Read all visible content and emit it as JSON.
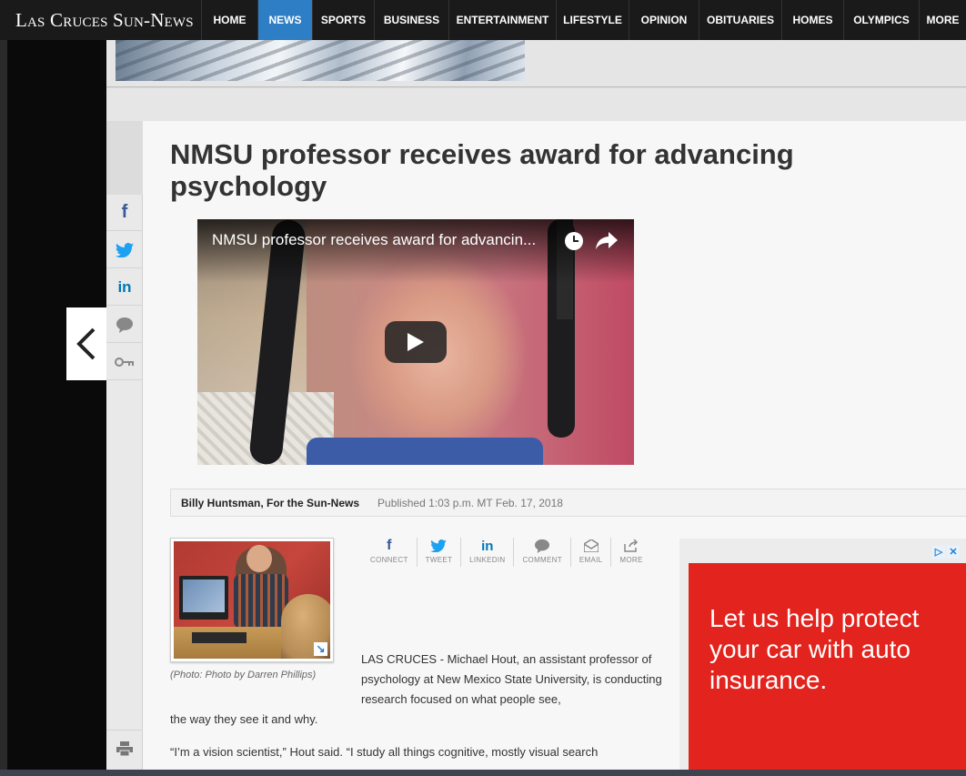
{
  "site": {
    "logo": "Las Cruces Sun-News"
  },
  "nav": {
    "items": [
      {
        "label": "HOME"
      },
      {
        "label": "NEWS",
        "active": true
      },
      {
        "label": "SPORTS"
      },
      {
        "label": "BUSINESS"
      },
      {
        "label": "ENTERTAINMENT"
      },
      {
        "label": "LIFESTYLE"
      },
      {
        "label": "OPINION"
      },
      {
        "label": "OBITUARIES"
      },
      {
        "label": "HOMES"
      },
      {
        "label": "OLYMPICS"
      },
      {
        "label": "MORE"
      }
    ],
    "active_color": "#2d7ec4"
  },
  "sidebar_share": {
    "icons": [
      "facebook-icon",
      "twitter-icon",
      "linkedin-icon",
      "comment-icon",
      "key-icon",
      "print-icon"
    ]
  },
  "article": {
    "headline": "NMSU professor receives award for advancing psychology",
    "video": {
      "title": "NMSU professor receives award for advancin..."
    },
    "byline": {
      "author": "Billy Huntsman, For the Sun-News",
      "published": "Published 1:03 p.m. MT Feb. 17, 2018"
    },
    "photo_credit": "(Photo: Photo by Darren Phillips)",
    "share_row": [
      {
        "icon": "facebook-icon",
        "label": "CONNECT"
      },
      {
        "icon": "twitter-icon",
        "label": "TWEET"
      },
      {
        "icon": "linkedin-icon",
        "label": "LINKEDIN"
      },
      {
        "icon": "comment-icon",
        "label": "COMMENT"
      },
      {
        "icon": "email-icon",
        "label": "EMAIL"
      },
      {
        "icon": "more-icon",
        "label": "MORE"
      }
    ],
    "lead": "LAS CRUCES - Michael Hout, an assistant professor of psychology at New Mexico State University, is conducting research focused on what people see,",
    "lead_tail": "the way they see it and why.",
    "para2": "“I’m a vision scientist,” Hout said. “I study all things cognitive, mostly visual search"
  },
  "ad": {
    "text": "Let us help protect your car with auto insurance.",
    "color": "#e3231d",
    "choices": [
      "▷",
      "✕"
    ]
  }
}
